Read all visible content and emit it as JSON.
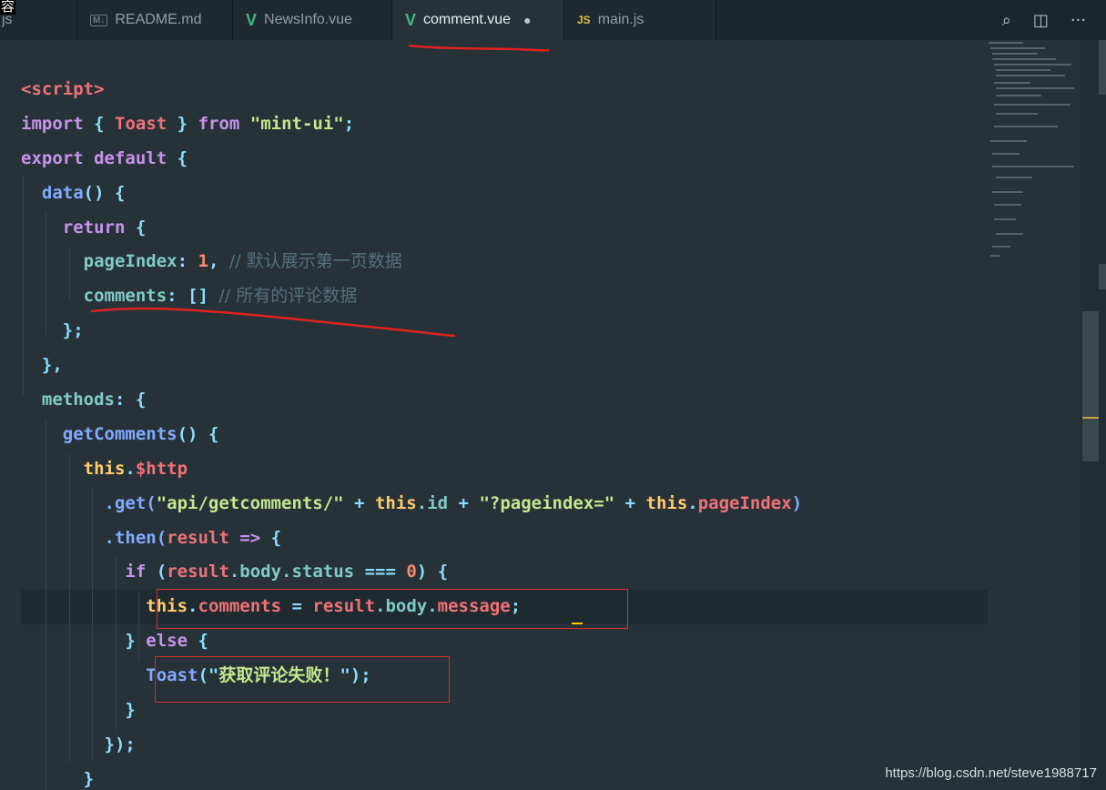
{
  "corner_text": "容",
  "tabs": [
    {
      "label": "js",
      "icon": "",
      "active": false
    },
    {
      "label": "README.md",
      "icon": "M↓",
      "active": false
    },
    {
      "label": "NewsInfo.vue",
      "icon": "V",
      "active": false
    },
    {
      "label": "comment.vue",
      "icon": "V",
      "active": true,
      "modified_dot": "●"
    },
    {
      "label": "main.js",
      "icon": "JS",
      "active": false
    }
  ],
  "toolbar": {
    "search_icon": "⌕",
    "split_icon": "◫",
    "more_icon": "···"
  },
  "code": {
    "l1": {
      "t1": "<script>"
    },
    "l2": {
      "t1": "import",
      "t2": "{",
      "t3": "Toast",
      "t4": "}",
      "t5": "from",
      "t6": "\"mint-ui\"",
      "t7": ";"
    },
    "l3": {
      "t1": "export",
      "t2": "default",
      "t3": "{"
    },
    "l4": {
      "t1": "data",
      "t2": "()",
      "t3": "{"
    },
    "l5": {
      "t1": "return",
      "t2": "{"
    },
    "l6": {
      "t1": "pageIndex",
      "t2": ":",
      "t3": "1",
      "t4": ",",
      "t5": "// 默认展示第一页数据"
    },
    "l7": {
      "t1": "comments",
      "t2": ":",
      "t3": "[]",
      "t4": "// 所有的评论数据"
    },
    "l8": {
      "t1": "};"
    },
    "l9": {
      "t1": "},"
    },
    "l10": {
      "t1": "methods",
      "t2": ":",
      "t3": "{"
    },
    "l11": {
      "t1": "getComments",
      "t2": "()",
      "t3": "{"
    },
    "l12": {
      "t1": "this",
      "t2": ".",
      "t3": "$http"
    },
    "l13": {
      "t1": ".get(",
      "t2": "\"api/getcomments/\"",
      "t3": "+",
      "t4": "this",
      "t5": ".id",
      "t6": "+",
      "t7": "\"?pageindex=\"",
      "t8": "+",
      "t9": "this",
      "t10": ".",
      "t11": "pageIndex",
      "t12": ")"
    },
    "l14": {
      "t1": ".then(",
      "t2": "result",
      "t3": "=>",
      "t4": "{"
    },
    "l15": {
      "t1": "if",
      "t2": "(",
      "t3": "result",
      "t4": ".body.status",
      "t5": "===",
      "t6": "0",
      "t7": ")",
      "t8": "{"
    },
    "l16": {
      "t1": "this",
      "t2": ".",
      "t3": "comments",
      "t4": "=",
      "t5": "result",
      "t6": ".body.",
      "t7": "message",
      "t8": ";"
    },
    "l17": {
      "t1": "}",
      "t2": "else",
      "t3": "{"
    },
    "l18": {
      "t1": "Toast",
      "t2": "(\"",
      "t3": "获取评论失败！",
      "t4": "\");"
    },
    "l19": {
      "t1": "}"
    },
    "l20": {
      "t1": "});"
    },
    "l21": {
      "t1": "}"
    }
  },
  "watermark": "https://blog.csdn.net/steve1988717",
  "colors": {
    "background": "#263238",
    "annotation_red": "#d32f2f",
    "tag": "#f07178",
    "keyword": "#c792ea",
    "string": "#c3e88d",
    "property": "#80cbc4"
  }
}
